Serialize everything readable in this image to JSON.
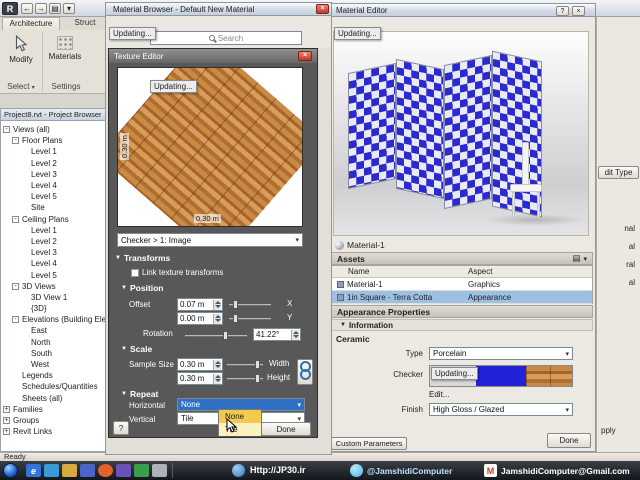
{
  "colors": {
    "selection_blue": "#2f6fc4",
    "checker_blue": "#2a2ace",
    "close_red": "#c03a2b",
    "option_yellow": "#f2cb4e",
    "row_selected": "#9dc1e4"
  },
  "glyphs": {
    "dropdown": "▾",
    "collapse": "▼",
    "close": "×",
    "help": "?",
    "undo": "←",
    "redo": "→",
    "menu": "▤",
    "app": "R",
    "ie": "e",
    "gmail": "M"
  },
  "ribbon": {
    "tab_architecture": "Architecture",
    "tab_structure": "Struct",
    "modify": "Modify",
    "materials": "Materials",
    "select": "Select",
    "settings": "Settings"
  },
  "project_browser": {
    "title": "Project8.rvt - Project Browser",
    "tree": [
      {
        "label": "Views (all)",
        "level": 0,
        "box": "-"
      },
      {
        "label": "Floor Plans",
        "level": 1,
        "box": "-"
      },
      {
        "label": "Level 1",
        "level": 2,
        "box": ""
      },
      {
        "label": "Level 2",
        "level": 2,
        "box": ""
      },
      {
        "label": "Level 3",
        "level": 2,
        "box": ""
      },
      {
        "label": "Level 4",
        "level": 2,
        "box": ""
      },
      {
        "label": "Level 5",
        "level": 2,
        "box": ""
      },
      {
        "label": "Site",
        "level": 2,
        "box": ""
      },
      {
        "label": "Ceiling Plans",
        "level": 1,
        "box": "-"
      },
      {
        "label": "Level 1",
        "level": 2,
        "box": ""
      },
      {
        "label": "Level 2",
        "level": 2,
        "box": ""
      },
      {
        "label": "Level 3",
        "level": 2,
        "box": ""
      },
      {
        "label": "Level 4",
        "level": 2,
        "box": ""
      },
      {
        "label": "Level 5",
        "level": 2,
        "box": ""
      },
      {
        "label": "3D Views",
        "level": 1,
        "box": "-"
      },
      {
        "label": "3D View 1",
        "level": 2,
        "box": ""
      },
      {
        "label": "{3D}",
        "level": 2,
        "box": ""
      },
      {
        "label": "Elevations (Building Ele",
        "level": 1,
        "box": "-"
      },
      {
        "label": "East",
        "level": 2,
        "box": ""
      },
      {
        "label": "North",
        "level": 2,
        "box": ""
      },
      {
        "label": "South",
        "level": 2,
        "box": ""
      },
      {
        "label": "West",
        "level": 2,
        "box": ""
      },
      {
        "label": "Legends",
        "level": 1,
        "box": ""
      },
      {
        "label": "Schedules/Quantities",
        "level": 1,
        "box": ""
      },
      {
        "label": "Sheets (all)",
        "level": 1,
        "box": ""
      },
      {
        "label": "Families",
        "level": 0,
        "box": "+"
      },
      {
        "label": "Groups",
        "level": 0,
        "box": "+"
      },
      {
        "label": "Revit Links",
        "level": 0,
        "box": "+"
      }
    ]
  },
  "material_browser": {
    "title": "Material Browser - Default New Material",
    "search": "Search",
    "updating": "Updating..."
  },
  "texture_editor": {
    "title": "Texture Editor",
    "updating": "Updating...",
    "dim_height": "0.30 m",
    "dim_width": "0.30 m",
    "map_selector": "Checker > 1: Image",
    "transforms": "Transforms",
    "link_transforms": "Link texture transforms",
    "position": "Position",
    "offset": "Offset",
    "offset_x": "0.07 m",
    "axis_x": "X",
    "offset_y": "0.00 m",
    "axis_y": "Y",
    "rotation": "Rotation",
    "rotation_value": "41.22°",
    "scale": "Scale",
    "sample_size": "Sample Size",
    "width_value": "0.30 m",
    "width": "Width",
    "height_value": "0.30 m",
    "height": "Height",
    "repeat": "Repeat",
    "horizontal": "Horizontal",
    "horizontal_value": "None",
    "vertical": "Vertical",
    "vertical_value": "Tile",
    "options": [
      "None",
      "Tile"
    ],
    "help": "?",
    "done": "Done"
  },
  "material_editor": {
    "title": "Material Editor",
    "updating": "Updating...",
    "material_name": "Material-1",
    "assets": "Assets",
    "col_name": "Name",
    "col_aspect": "Aspect",
    "rows": [
      {
        "name": "Material-1",
        "aspect": "Graphics",
        "selected": false
      },
      {
        "name": "1in Square - Terra Cotta",
        "aspect": "Appearance",
        "selected": true
      }
    ],
    "appearance_properties": "Appearance Properties",
    "information": "Information",
    "ceramic": "Ceramic",
    "type": "Type",
    "type_value": "Porcelain",
    "checker": "Checker",
    "checker_updating": "Updating...",
    "edit": "Edit...",
    "finish": "Finish",
    "finish_value": "High Gloss / Glazed",
    "custom_parameters": "Custom Parameters",
    "done": "Done"
  },
  "right_panel": {
    "edit_type": "dit Type",
    "fragments": [
      "nal",
      "al",
      "ral",
      "al"
    ],
    "apply": "pply"
  },
  "status_bar": {
    "ready": "Ready"
  },
  "taskbar": {
    "url": "Http://JP30.ir",
    "handle": "@JamshidiComputer",
    "email": "JamshidiComputer@Gmail.com"
  }
}
